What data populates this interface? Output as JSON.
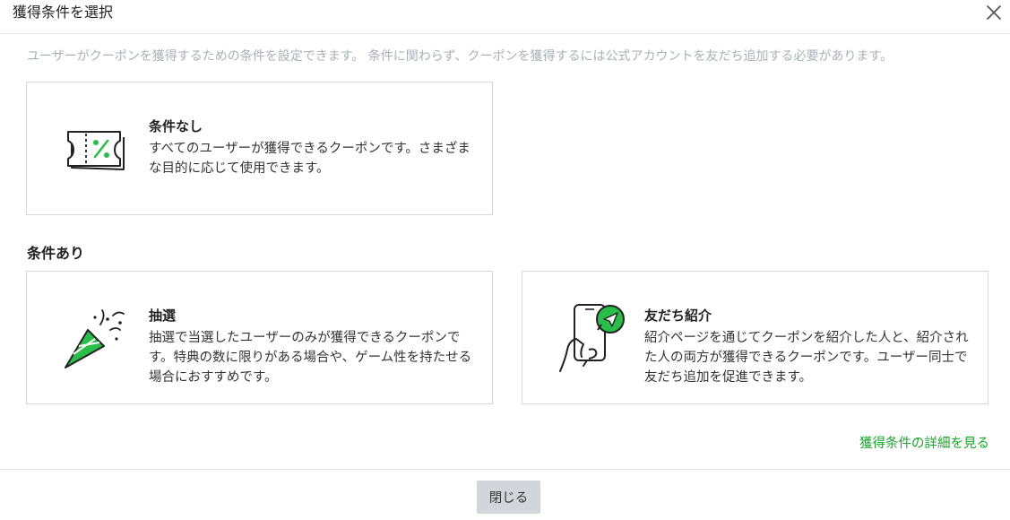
{
  "dialog": {
    "title": "獲得条件を選択",
    "description": "ユーザーがクーポンを獲得するための条件を設定できます。 条件に関わらず、クーポンを獲得するには公式アカウントを友だち追加する必要があります。"
  },
  "no_condition": {
    "title": "条件なし",
    "description": "すべてのユーザーが獲得できるクーポンです。さまざまな目的に応じて使用できます。",
    "icon": "coupon-ticket-icon"
  },
  "with_condition": {
    "heading": "条件あり",
    "lottery": {
      "title": "抽選",
      "description": "抽選で当選したユーザーのみが獲得できるクーポンです。特典の数に限りがある場合や、ゲーム性を持たせる場合におすすめです。",
      "icon": "party-popper-icon"
    },
    "referral": {
      "title": "友だち紹介",
      "description": "紹介ページを通じてクーポンを紹介した人と、紹介された人の両方が獲得できるクーポンです。ユーザー同士で友だち追加を促進できます。",
      "icon": "phone-share-icon"
    }
  },
  "detail_link": "獲得条件の詳細を見る",
  "footer": {
    "close_label": "閉じる"
  },
  "colors": {
    "accent_green": "#1aa52b",
    "icon_green": "#2bbd4a",
    "muted_text": "#a9b0b8",
    "button_gray": "#d2d6db"
  }
}
